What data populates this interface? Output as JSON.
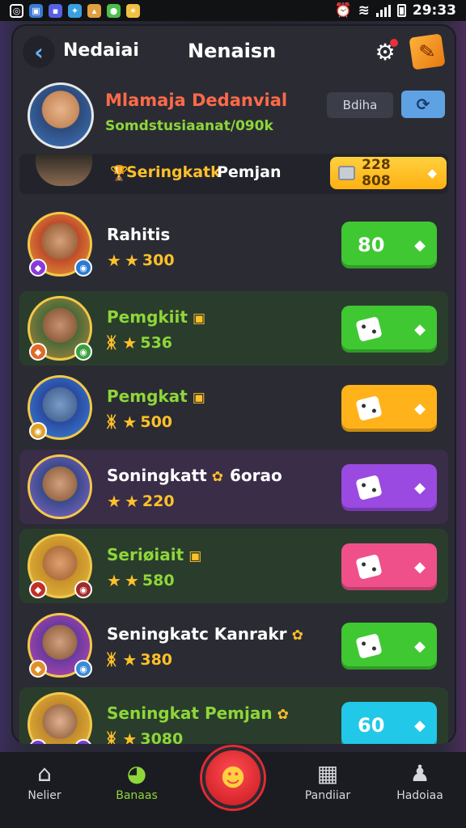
{
  "statusbar": {
    "apps": [
      {
        "icon": "whatsapp-icon",
        "glyph": "◎",
        "color": "#ffffff"
      },
      {
        "icon": "gallery-icon",
        "glyph": "▣",
        "color": "#3a7bd5"
      },
      {
        "icon": "game-icon",
        "glyph": "▪",
        "color": "#5560e6"
      },
      {
        "icon": "app-icon",
        "glyph": "✦",
        "color": "#3aa0e0"
      },
      {
        "icon": "shop-icon",
        "glyph": "▴",
        "color": "#e0a040"
      },
      {
        "icon": "chat-icon",
        "glyph": "●",
        "color": "#4ac04a"
      },
      {
        "icon": "star-app-icon",
        "glyph": "✶",
        "color": "#f0c040"
      }
    ],
    "alarm_glyph": "⏰",
    "wifi_glyph": "≋",
    "time": "29:33"
  },
  "header": {
    "back_glyph": "‹",
    "left_label": "Nedaiai",
    "title": "Nenaisn",
    "settings_glyph": "⚙",
    "edit_glyph": "✎"
  },
  "profile": {
    "name": "Mlamaja Dedanvial",
    "subtitle": "Somdstusiaanat/090k",
    "button_label": "Bdiha",
    "button2_glyph": "⟳"
  },
  "subheader": {
    "icon_glyph": "🏆",
    "label": "Seringkatk",
    "label2": "Pemjan",
    "pill_value": "228 808",
    "pill_dia": "◆"
  },
  "rows": [
    {
      "name": "Rahitis",
      "tag": "",
      "extra": "",
      "prefix": "",
      "score": "300",
      "button_text": "80",
      "button_dice": false,
      "bg": "#2b2c33",
      "btn_color": "#3fc832",
      "name_color": "#ffffff",
      "score_color": "#ffc02a",
      "avatar": "radial-gradient(circle at 50% 45%, #d6a07a 0%, #a0663e 40%, #c04a2a 42%, #e9a23a 100%)",
      "badges": [
        {
          "glyph": "◆",
          "color": "#8a3ad6"
        },
        {
          "glyph": "◉",
          "color": "#2a7ad6"
        }
      ]
    },
    {
      "name": "Pemgkiit",
      "tag": "▣",
      "extra": "",
      "prefix": "ᛤ",
      "score": "536",
      "button_text": "",
      "button_dice": true,
      "bg": "#2a3d2c",
      "btn_color": "#3fc832",
      "name_color": "#8ed63a",
      "score_color": "#8ed63a",
      "avatar": "radial-gradient(circle at 50% 45%, #c89070 0%, #90603e 38%, #4a6a3a 40%, #b88a3a 100%)",
      "badges": [
        {
          "glyph": "◆",
          "color": "#e06a2a"
        },
        {
          "glyph": "◉",
          "color": "#3aa03a"
        }
      ]
    },
    {
      "name": "Pemgkat",
      "tag": "▣",
      "extra": "",
      "prefix": "ᛤ",
      "score": "500",
      "button_text": "",
      "button_dice": true,
      "bg": "#2b2c33",
      "btn_color": "#ffb21a",
      "name_color": "#8ed63a",
      "score_color": "#ffc02a",
      "avatar": "radial-gradient(circle at 50% 45%, #7a9ac8 0%, #4a6a98 38%, #2a4aa0 40%, #3a8ae0 100%)",
      "badges": [
        {
          "glyph": "◉",
          "color": "#e0a02a"
        }
      ]
    },
    {
      "name": "Soningkatt",
      "tag": "✿",
      "extra": "6orao",
      "prefix": "",
      "score": "220",
      "button_text": "",
      "button_dice": true,
      "bg": "#3a2d48",
      "btn_color": "#9a4ae0",
      "name_color": "#ffffff",
      "score_color": "#ffc02a",
      "avatar": "radial-gradient(circle at 50% 45%, #d0a080 0%, #9a6a48 38%, #3a4a8a 40%, #8a6ad0 100%)",
      "badges": []
    },
    {
      "name": "Seriøiait",
      "tag": "▣",
      "extra": "",
      "prefix": "",
      "score": "580",
      "button_text": "",
      "button_dice": true,
      "bg": "#2a3d2c",
      "btn_color": "#f0508a",
      "name_color": "#8ed63a",
      "score_color": "#8ed63a",
      "avatar": "radial-gradient(circle at 50% 45%, #e0a070 0%, #b0703e 38%, #c8902a 40%, #e8c040 100%)",
      "badges": [
        {
          "glyph": "◆",
          "color": "#c0302a"
        },
        {
          "glyph": "◉",
          "color": "#a02a2a"
        }
      ]
    },
    {
      "name": "Seningkatc Kanrakr",
      "tag": "✿",
      "extra": "",
      "prefix": "ᛤ",
      "score": "380",
      "button_text": "",
      "button_dice": true,
      "bg": "#2b2c33",
      "btn_color": "#3fc832",
      "name_color": "#ffffff",
      "score_color": "#ffc02a",
      "avatar": "radial-gradient(circle at 50% 45%, #d0a080 0%, #9a6a48 38%, #6a3aa0 40%, #c04ab0 100%)",
      "badges": [
        {
          "glyph": "◆",
          "color": "#e0902a"
        },
        {
          "glyph": "◉",
          "color": "#3a8ad6"
        }
      ]
    },
    {
      "name": "Seningkat Pemjan",
      "tag": "✿",
      "extra": "",
      "prefix": "ᛤ",
      "score": "3080",
      "button_text": "60",
      "button_dice": false,
      "bg": "#2a3d2c",
      "btn_color": "#22c8e8",
      "name_color": "#8ed63a",
      "score_color": "#8ed63a",
      "avatar": "radial-gradient(circle at 50% 45%, #e0b090 0%, #a0704e 38%, #c08a2a 40%, #f0c040 100%)",
      "badges": [
        {
          "glyph": "◆",
          "color": "#7a3ad6"
        },
        {
          "glyph": "◉",
          "color": "#7a3ad6"
        }
      ]
    }
  ],
  "bottomnav": {
    "items": [
      {
        "label": "Nelier",
        "glyph": "⌂",
        "icon": "home-icon",
        "color": "#d6d8df"
      },
      {
        "label": "Banaas",
        "glyph": "◕",
        "icon": "chat-bubble-icon",
        "color": "#8ed63a"
      },
      {
        "label": "Pandiiar",
        "glyph": "▦",
        "icon": "calendar-icon",
        "color": "#d6d8df"
      },
      {
        "label": "Hadoiaa",
        "glyph": "♟",
        "icon": "profile-icon",
        "color": "#d6d8df"
      }
    ],
    "center_glyph": "☻"
  }
}
